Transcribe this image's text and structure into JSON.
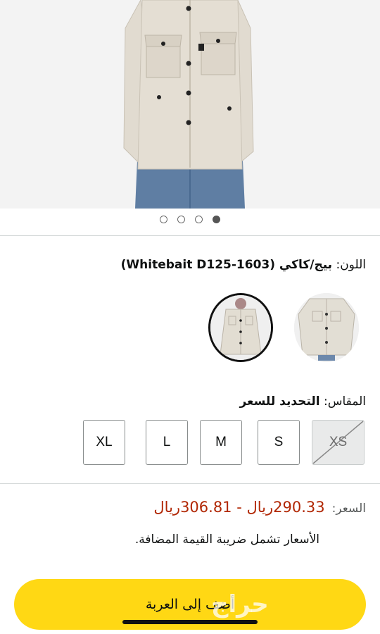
{
  "product": {
    "image_icon": "shirt-jacket-model-photo",
    "pager": {
      "count": 4,
      "active_index": 3
    }
  },
  "color": {
    "label": "اللون:",
    "value": "بيج/كاكي (Whitebait D125-1603)",
    "swatches": [
      {
        "name": "beige-jacket-flat",
        "selected": false
      },
      {
        "name": "beige-jacket-model",
        "selected": true
      }
    ]
  },
  "size": {
    "label": "المقاس:",
    "value": "التحديد للسعر",
    "options": [
      {
        "label": "XL",
        "disabled": false
      },
      {
        "label": "L",
        "disabled": false
      },
      {
        "label": "M",
        "disabled": false
      },
      {
        "label": "S",
        "disabled": false
      },
      {
        "label": "XS",
        "disabled": true
      }
    ]
  },
  "price": {
    "label": "السعر:",
    "range": "290.33ريال - 306.81ريال",
    "vat_note": "الأسعار تشمل ضريبة القيمة المضافة."
  },
  "cart": {
    "label": "أضف إلى العربة"
  },
  "watermark": {
    "text": "حراج"
  },
  "colors": {
    "price": "#b12704",
    "cart_button": "#ffd814",
    "background": "#ffffff"
  }
}
